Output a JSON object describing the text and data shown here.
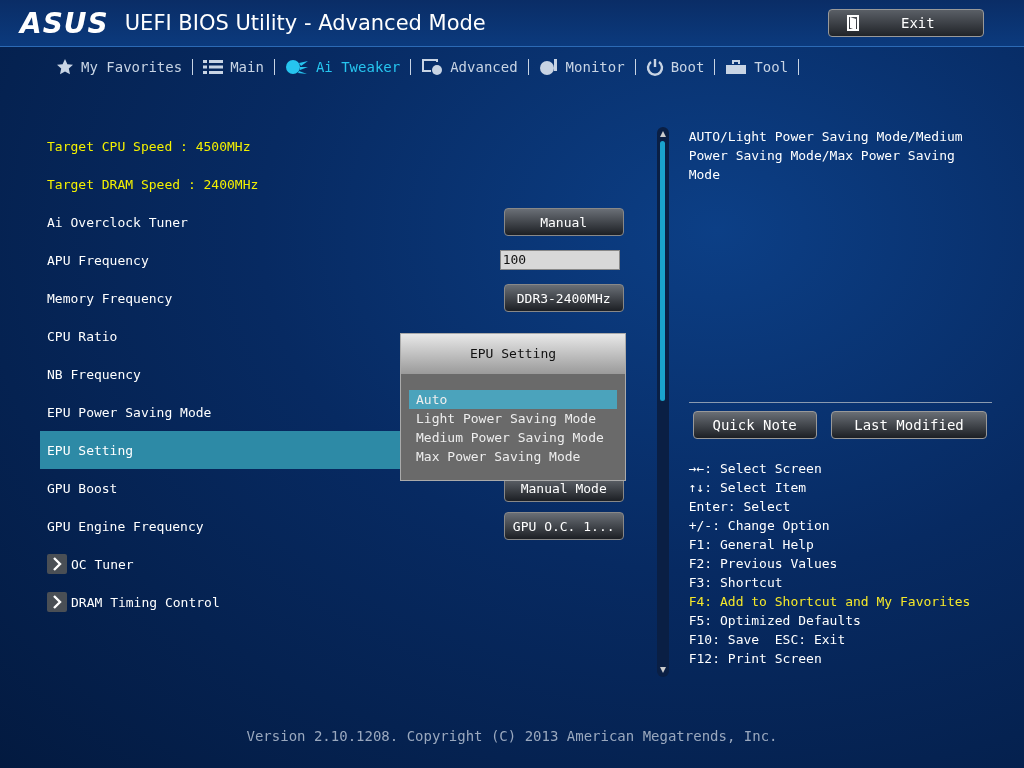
{
  "header": {
    "brand": "ASUS",
    "title": "UEFI BIOS Utility - Advanced Mode",
    "exit_button": "Exit"
  },
  "tabs": [
    {
      "label": "My Favorites",
      "selected": false
    },
    {
      "label": "Main",
      "selected": false
    },
    {
      "label": "Ai Tweaker",
      "selected": true
    },
    {
      "label": "Advanced",
      "selected": false
    },
    {
      "label": "Monitor",
      "selected": false
    },
    {
      "label": "Boot",
      "selected": false
    },
    {
      "label": "Tool",
      "selected": false
    }
  ],
  "settings": [
    {
      "kind": "info",
      "label": "Target CPU Speed : 4500MHz",
      "selected": false
    },
    {
      "kind": "info",
      "label": "Target DRAM Speed : 2400MHz",
      "selected": false
    },
    {
      "kind": "button",
      "label": "Ai Overclock Tuner",
      "value": "Manual",
      "selected": false
    },
    {
      "kind": "input",
      "label": "APU Frequency",
      "value": "100",
      "selected": false
    },
    {
      "kind": "button",
      "label": "Memory Frequency",
      "value": "DDR3-2400MHz",
      "selected": false
    },
    {
      "kind": "plain",
      "label": "CPU Ratio",
      "selected": false
    },
    {
      "kind": "plain",
      "label": "NB Frequency",
      "selected": false
    },
    {
      "kind": "plain",
      "label": "EPU Power Saving Mode",
      "selected": false
    },
    {
      "kind": "plain",
      "label": "EPU Setting",
      "selected": true
    },
    {
      "kind": "button",
      "label": "GPU Boost",
      "value": "Manual Mode",
      "selected": false
    },
    {
      "kind": "button",
      "label": "GPU Engine Frequency",
      "value": "GPU O.C. 1...",
      "selected": false
    },
    {
      "kind": "submenu",
      "label": "OC Tuner",
      "selected": false
    },
    {
      "kind": "submenu",
      "label": "DRAM Timing Control",
      "selected": false
    }
  ],
  "popup": {
    "title": "EPU Setting",
    "options": [
      {
        "label": "Auto",
        "selected": true
      },
      {
        "label": "Light Power Saving Mode",
        "selected": false
      },
      {
        "label": "Medium Power Saving Mode",
        "selected": false
      },
      {
        "label": "Max Power Saving Mode",
        "selected": false
      }
    ]
  },
  "help": {
    "description": "AUTO/Light Power Saving Mode/Medium Power Saving Mode/Max Power Saving Mode",
    "buttons": [
      "Quick Note",
      "Last Modified"
    ],
    "keys": [
      {
        "text": "→←: Select Screen",
        "highlight": false
      },
      {
        "text": "↑↓: Select Item",
        "highlight": false
      },
      {
        "text": "Enter: Select",
        "highlight": false
      },
      {
        "text": "+/-: Change Option",
        "highlight": false
      },
      {
        "text": "F1: General Help",
        "highlight": false
      },
      {
        "text": "F2: Previous Values",
        "highlight": false
      },
      {
        "text": "F3: Shortcut",
        "highlight": false
      },
      {
        "text": "F4: Add to Shortcut and My Favorites",
        "highlight": true
      },
      {
        "text": "F5: Optimized Defaults",
        "highlight": false
      },
      {
        "text": "F10: Save  ESC: Exit",
        "highlight": false
      },
      {
        "text": "F12: Print Screen",
        "highlight": false
      }
    ]
  },
  "footer": "Version 2.10.1208. Copyright (C) 2013 American Megatrends, Inc."
}
